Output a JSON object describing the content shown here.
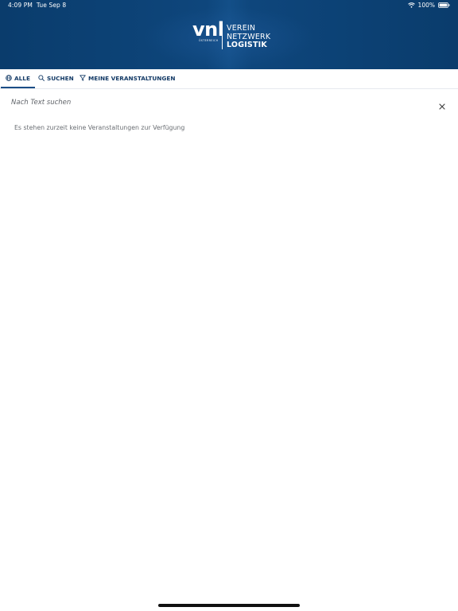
{
  "status_bar": {
    "time": "4:09 PM",
    "date": "Tue Sep 8",
    "battery": "100%",
    "icons": [
      "wifi-icon",
      "battery-icon"
    ]
  },
  "header": {
    "logo_mark": "vnl",
    "logo_sub": "ÖSTERREICH",
    "logo_line1": "VEREIN",
    "logo_line2": "NETZWERK",
    "logo_line3": "LOGISTIK",
    "background_color": "#0e467c"
  },
  "tabs": [
    {
      "label": "ALLE",
      "icon": "globe-icon",
      "active": true
    },
    {
      "label": "SUCHEN",
      "icon": "search-icon",
      "active": false
    },
    {
      "label": "MEINE VERANSTALTUNGEN",
      "icon": "filter-icon",
      "active": false
    }
  ],
  "search": {
    "placeholder": "Nach Text suchen",
    "value": ""
  },
  "empty_message": "Es stehen zurzeit keine Veranstaltungen zur Verfügung",
  "colors": {
    "accent": "#1b4d86",
    "tab_text": "#133a66",
    "muted_text": "#6a6e73"
  }
}
